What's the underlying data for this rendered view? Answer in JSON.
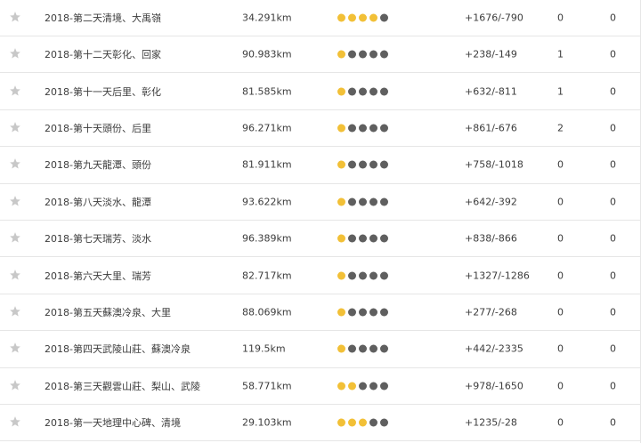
{
  "icons": {
    "star": "star-icon"
  },
  "colors": {
    "dot_on": "#f2c037",
    "dot_off": "#5f5f5f",
    "star": "#c8c8c8"
  },
  "rows": [
    {
      "name": "2018-第二天清境、大禹嶺",
      "distance": "34.291km",
      "rating": 4,
      "elevation": "+1676/-790",
      "count1": "0",
      "count2": "0"
    },
    {
      "name": "2018-第十二天彰化、回家",
      "distance": "90.983km",
      "rating": 1,
      "elevation": "+238/-149",
      "count1": "1",
      "count2": "0"
    },
    {
      "name": "2018-第十一天后里、彰化",
      "distance": "81.585km",
      "rating": 1,
      "elevation": "+632/-811",
      "count1": "1",
      "count2": "0"
    },
    {
      "name": "2018-第十天頭份、后里",
      "distance": "96.271km",
      "rating": 1,
      "elevation": "+861/-676",
      "count1": "2",
      "count2": "0"
    },
    {
      "name": "2018-第九天龍潭、頭份",
      "distance": "81.911km",
      "rating": 1,
      "elevation": "+758/-1018",
      "count1": "0",
      "count2": "0"
    },
    {
      "name": "2018-第八天淡水、龍潭",
      "distance": "93.622km",
      "rating": 1,
      "elevation": "+642/-392",
      "count1": "0",
      "count2": "0"
    },
    {
      "name": "2018-第七天瑞芳、淡水",
      "distance": "96.389km",
      "rating": 1,
      "elevation": "+838/-866",
      "count1": "0",
      "count2": "0"
    },
    {
      "name": "2018-第六天大里、瑞芳",
      "distance": "82.717km",
      "rating": 1,
      "elevation": "+1327/-1286",
      "count1": "0",
      "count2": "0"
    },
    {
      "name": "2018-第五天蘇澳冷泉、大里",
      "distance": "88.069km",
      "rating": 1,
      "elevation": "+277/-268",
      "count1": "0",
      "count2": "0"
    },
    {
      "name": "2018-第四天武陵山莊、蘇澳冷泉",
      "distance": "119.5km",
      "rating": 1,
      "elevation": "+442/-2335",
      "count1": "0",
      "count2": "0"
    },
    {
      "name": "2018-第三天觀雲山莊、梨山、武陵",
      "distance": "58.771km",
      "rating": 2,
      "elevation": "+978/-1650",
      "count1": "0",
      "count2": "0"
    },
    {
      "name": "2018-第一天地理中心碑、清境",
      "distance": "29.103km",
      "rating": 3,
      "elevation": "+1235/-28",
      "count1": "0",
      "count2": "0"
    }
  ]
}
